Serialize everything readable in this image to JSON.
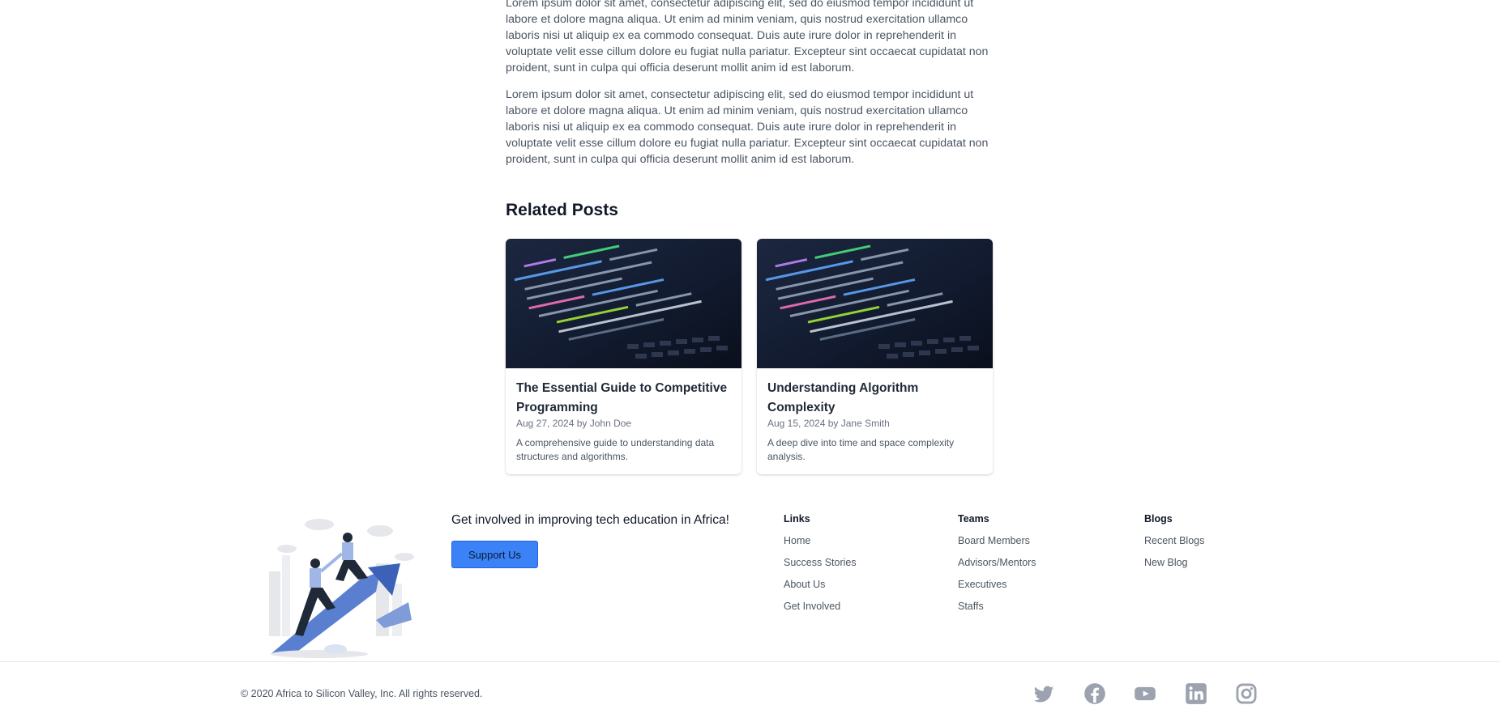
{
  "article": {
    "paragraphs": [
      "Lorem ipsum dolor sit amet, consectetur adipiscing elit, sed do eiusmod tempor incididunt ut labore et dolore magna aliqua. Ut enim ad minim veniam, quis nostrud exercitation ullamco laboris nisi ut aliquip ex ea commodo consequat. Duis aute irure dolor in reprehenderit in voluptate velit esse cillum dolore eu fugiat nulla pariatur. Excepteur sint occaecat cupidatat non proident, sunt in culpa qui officia deserunt mollit anim id est laborum.",
      "Lorem ipsum dolor sit amet, consectetur adipiscing elit, sed do eiusmod tempor incididunt ut labore et dolore magna aliqua. Ut enim ad minim veniam, quis nostrud exercitation ullamco laboris nisi ut aliquip ex ea commodo consequat. Duis aute irure dolor in reprehenderit in voluptate velit esse cillum dolore eu fugiat nulla pariatur. Excepteur sint occaecat cupidatat non proident, sunt in culpa qui officia deserunt mollit anim id est laborum."
    ]
  },
  "related": {
    "title": "Related Posts",
    "posts": [
      {
        "title": "The Essential Guide to Competitive Programming",
        "meta": "Aug 27, 2024 by John Doe",
        "description": "A comprehensive guide to understanding data structures and algorithms."
      },
      {
        "title": "Understanding Algorithm Complexity",
        "meta": "Aug 15, 2024 by Jane Smith",
        "description": "A deep dive into time and space complexity analysis."
      }
    ]
  },
  "footer": {
    "cta_text": "Get involved in improving tech education in Africa!",
    "support_label": "Support Us",
    "columns": [
      {
        "title": "Links",
        "items": [
          "Home",
          "Success Stories",
          "About Us",
          "Get Involved"
        ]
      },
      {
        "title": "Teams",
        "items": [
          "Board Members",
          "Advisors/Mentors",
          "Executives",
          "Staffs"
        ]
      },
      {
        "title": "Blogs",
        "items": [
          "Recent Blogs",
          "New Blog"
        ]
      }
    ],
    "copyright": "© 2020 Africa to Silicon Valley, Inc. All rights reserved.",
    "social_icons": [
      "twitter-icon",
      "facebook-icon",
      "youtube-icon",
      "linkedin-icon",
      "instagram-icon"
    ]
  },
  "colors": {
    "accent": "#3b82f6",
    "icon_gray": "#9ca3af"
  }
}
